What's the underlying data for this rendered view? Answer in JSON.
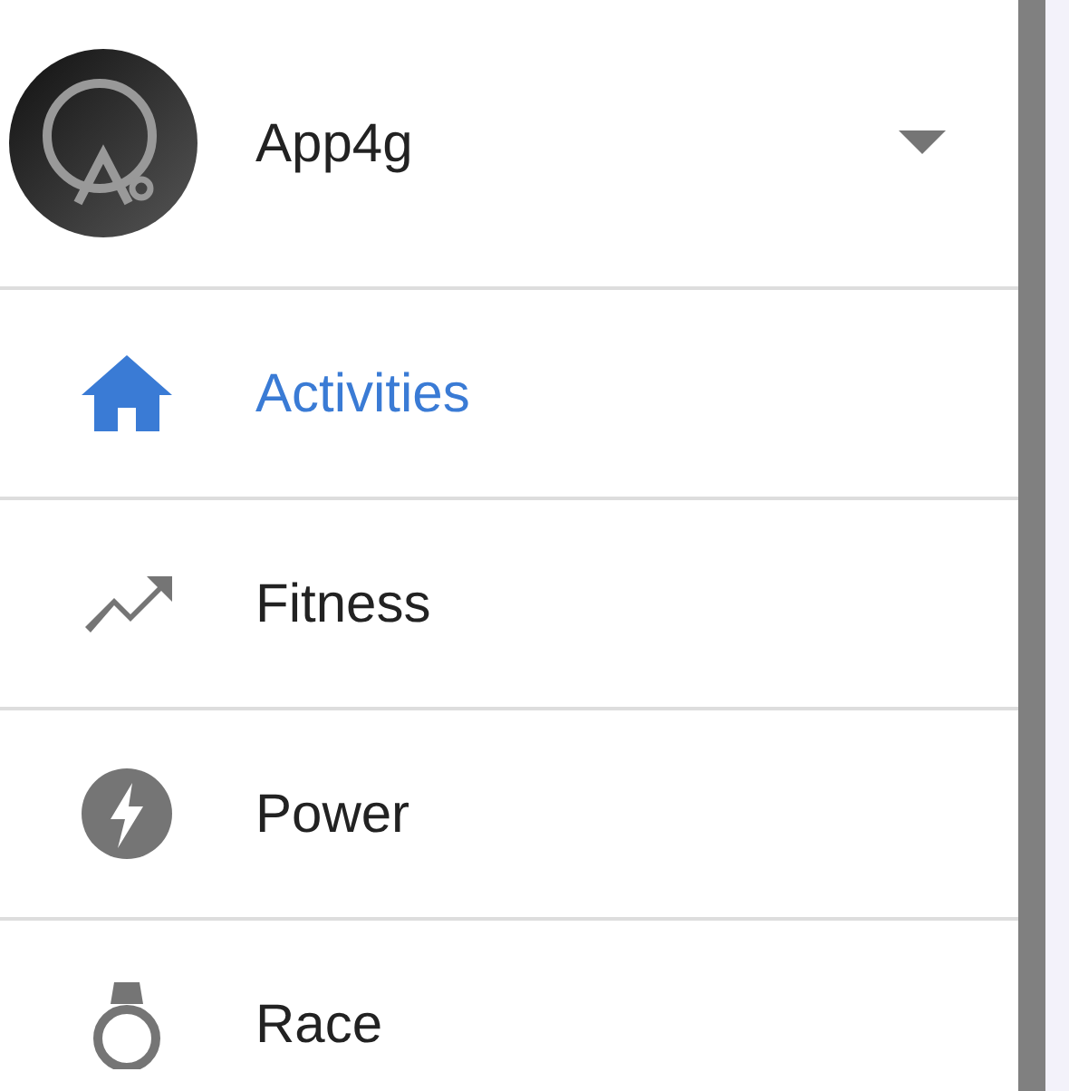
{
  "account": {
    "name": "App4g"
  },
  "menu": [
    {
      "label": "Activities",
      "selected": true
    },
    {
      "label": "Fitness",
      "selected": false
    },
    {
      "label": "Power",
      "selected": false
    },
    {
      "label": "Race",
      "selected": false
    }
  ]
}
